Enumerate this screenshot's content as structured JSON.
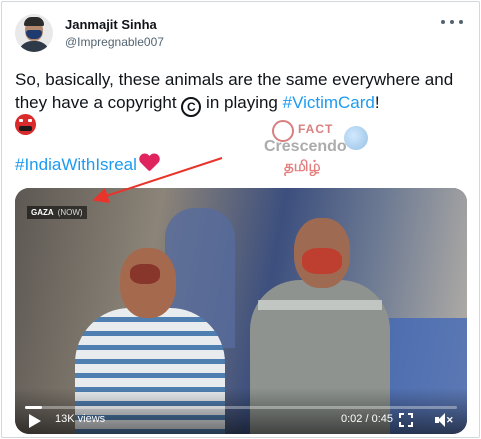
{
  "author": {
    "display_name": "Janmajit Sinha",
    "handle": "@Impregnable007"
  },
  "tweet": {
    "line1": "So, basically, these animals are the same everywhere",
    "line2_before": "and they have a copyright ",
    "copyright_symbol": "C",
    "line2_middle": " in playing ",
    "hashtag_victimcard": "#VictimCard",
    "line2_end": "!",
    "hashtag_india": "#IndiaWithIsreal"
  },
  "watermark": {
    "fact": "FACT",
    "name": "Crescendo",
    "language": "தமிழ்"
  },
  "video": {
    "source_tag": "GAZA",
    "source_tag_sub": "(NOW)",
    "views": "13K views",
    "time": "0:02 / 0:45",
    "progress": 0.04
  },
  "icons": {
    "more": "more-horizontal-icon",
    "emoji": "angry-face-emoji",
    "heart": "red-heart-emoji",
    "play": "play-icon",
    "fullscreen": "fullscreen-icon",
    "mute": "mute-icon"
  },
  "colors": {
    "link": "#1d9bf0",
    "heart": "#e0245e",
    "arrow": "#e8342b",
    "handle": "#536471"
  }
}
